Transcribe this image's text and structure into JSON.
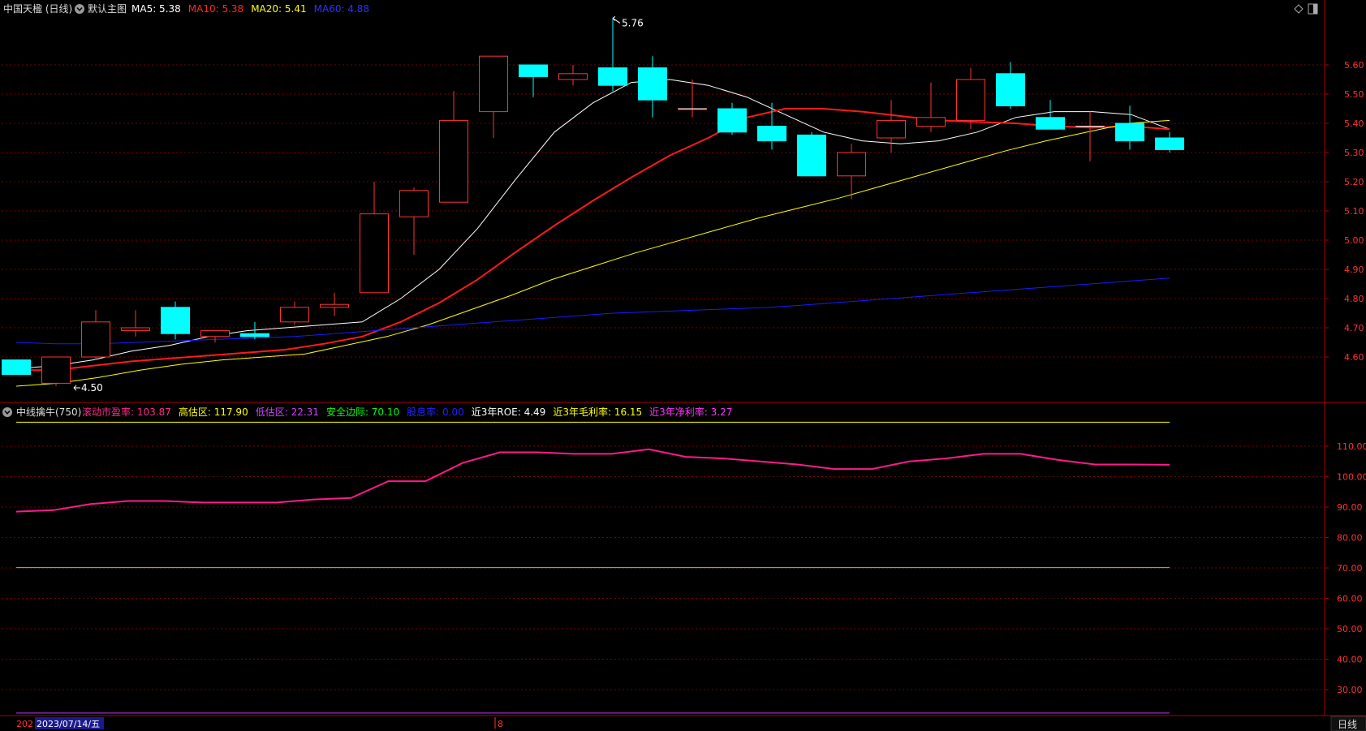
{
  "main_panel": {
    "stock_title": "中国天楹 (日线)",
    "indicator_name": "默认主图",
    "ma_labels": [
      {
        "text": "MA5: 5.38",
        "color": "#ffffff"
      },
      {
        "text": "MA10: 5.38",
        "color": "#ff2a2a"
      },
      {
        "text": "MA20: 5.41",
        "color": "#ffff00"
      },
      {
        "text": "MA60: 4.88",
        "color": "#3030ff"
      }
    ],
    "high_annotation": "5.76",
    "low_annotation": "4.50",
    "icons": [
      "dropdown-circle-icon",
      "diamond-icon",
      "panel-toggle-icon"
    ]
  },
  "sub_panel": {
    "indicator_name": "中线擒牛(750)",
    "labels": [
      {
        "text": "滚动市盈率: 103.87",
        "color": "#ff2a8a"
      },
      {
        "text": "高估区: 117.90",
        "color": "#ffff00"
      },
      {
        "text": "低估区: 22.31",
        "color": "#cc44ff"
      },
      {
        "text": "安全边际: 70.10",
        "color": "#00ff00"
      },
      {
        "text": "股息率: 0.00",
        "color": "#2222ff"
      },
      {
        "text": "近3年ROE: 4.49",
        "color": "#ffffff"
      },
      {
        "text": "近3年毛利率: 16.15",
        "color": "#ffff00"
      },
      {
        "text": "近3年净利率: 3.27",
        "color": "#ff33ff"
      }
    ]
  },
  "bottom_bar": {
    "year_prefix": "202",
    "cursor_date": "2023/07/14/五",
    "month_tick": "8",
    "period_label": "日线"
  },
  "colors": {
    "up": "#ff3333",
    "down": "#00ffff",
    "ma5": "#ffffff",
    "ma10": "#ff1a1a",
    "ma20": "#ffff00",
    "ma60": "#1a1aff",
    "pe_line": "#ff1a8c",
    "high_zone": "#ffff00",
    "low_zone": "#cc33ff",
    "safety": "#33ff33",
    "axis": "#aa0000",
    "grid": "#7a0000",
    "tick_text": "#ff3333"
  },
  "chart_data": [
    {
      "type": "candlestick",
      "y_ticks": [
        "5.60",
        "5.50",
        "5.40",
        "5.30",
        "5.20",
        "5.10",
        "5.00",
        "4.90",
        "4.80",
        "4.70",
        "4.60"
      ],
      "ylim": [
        4.48,
        5.78
      ],
      "grid": true,
      "candles": [
        {
          "open": 4.59,
          "close": 4.54,
          "high": 4.59,
          "low": 4.54
        },
        {
          "open": 4.51,
          "close": 4.6,
          "high": 4.6,
          "low": 4.5
        },
        {
          "open": 4.6,
          "close": 4.72,
          "high": 4.76,
          "low": 4.59
        },
        {
          "open": 4.69,
          "close": 4.7,
          "high": 4.76,
          "low": 4.67
        },
        {
          "open": 4.77,
          "close": 4.68,
          "high": 4.79,
          "low": 4.66
        },
        {
          "open": 4.67,
          "close": 4.69,
          "high": 4.69,
          "low": 4.65
        },
        {
          "open": 4.68,
          "close": 4.67,
          "high": 4.72,
          "low": 4.66
        },
        {
          "open": 4.72,
          "close": 4.77,
          "high": 4.79,
          "low": 4.71
        },
        {
          "open": 4.77,
          "close": 4.78,
          "high": 4.82,
          "low": 4.74
        },
        {
          "open": 4.82,
          "close": 5.09,
          "high": 5.2,
          "low": 4.82
        },
        {
          "open": 5.08,
          "close": 5.17,
          "high": 5.18,
          "low": 4.95
        },
        {
          "open": 5.13,
          "close": 5.41,
          "high": 5.51,
          "low": 5.13
        },
        {
          "open": 5.44,
          "close": 5.63,
          "high": 5.63,
          "low": 5.35
        },
        {
          "open": 5.6,
          "close": 5.56,
          "high": 5.6,
          "low": 5.49
        },
        {
          "open": 5.55,
          "close": 5.57,
          "high": 5.6,
          "low": 5.53
        },
        {
          "open": 5.59,
          "close": 5.53,
          "high": 5.76,
          "low": 5.51
        },
        {
          "open": 5.59,
          "close": 5.48,
          "high": 5.63,
          "low": 5.42
        },
        {
          "open": 5.45,
          "close": 5.45,
          "high": 5.55,
          "low": 5.42
        },
        {
          "open": 5.45,
          "close": 5.37,
          "high": 5.47,
          "low": 5.36
        },
        {
          "open": 5.39,
          "close": 5.34,
          "high": 5.47,
          "low": 5.31
        },
        {
          "open": 5.36,
          "close": 5.22,
          "high": 5.37,
          "low": 5.22
        },
        {
          "open": 5.22,
          "close": 5.3,
          "high": 5.33,
          "low": 5.14
        },
        {
          "open": 5.35,
          "close": 5.41,
          "high": 5.48,
          "low": 5.3
        },
        {
          "open": 5.39,
          "close": 5.42,
          "high": 5.54,
          "low": 5.37
        },
        {
          "open": 5.41,
          "close": 5.55,
          "high": 5.59,
          "low": 5.38
        },
        {
          "open": 5.57,
          "close": 5.46,
          "high": 5.61,
          "low": 5.45
        },
        {
          "open": 5.42,
          "close": 5.38,
          "high": 5.48,
          "low": 5.38
        },
        {
          "open": 5.39,
          "close": 5.39,
          "high": 5.44,
          "low": 5.27
        },
        {
          "open": 5.4,
          "close": 5.34,
          "high": 5.46,
          "low": 5.31
        },
        {
          "open": 5.35,
          "close": 5.31,
          "high": 5.37,
          "low": 5.3
        }
      ],
      "series": [
        {
          "name": "MA5",
          "values": [
            4.56,
            4.57,
            4.59,
            4.62,
            4.64,
            4.67,
            4.69,
            4.7,
            4.71,
            4.72,
            4.8,
            4.9,
            5.04,
            5.21,
            5.37,
            5.47,
            5.54,
            5.55,
            5.53,
            5.49,
            5.43,
            5.37,
            5.34,
            5.33,
            5.34,
            5.37,
            5.42,
            5.44,
            5.44,
            5.43,
            5.38
          ]
        },
        {
          "name": "MA10",
          "values": [
            4.555,
            4.555,
            4.57,
            4.585,
            4.595,
            4.605,
            4.615,
            4.625,
            4.645,
            4.67,
            4.72,
            4.785,
            4.865,
            4.96,
            5.05,
            5.135,
            5.215,
            5.29,
            5.35,
            5.42,
            5.45,
            5.45,
            5.44,
            5.425,
            5.41,
            5.405,
            5.4,
            5.39,
            5.385,
            5.39,
            5.38
          ]
        },
        {
          "name": "MA20",
          "values": [
            4.5,
            4.51,
            4.53,
            4.555,
            4.575,
            4.59,
            4.6,
            4.61,
            4.64,
            4.67,
            4.71,
            4.76,
            4.81,
            4.865,
            4.91,
            4.955,
            4.995,
            5.035,
            5.075,
            5.11,
            5.145,
            5.185,
            5.225,
            5.265,
            5.305,
            5.34,
            5.37,
            5.4,
            5.41
          ]
        },
        {
          "name": "MA60",
          "values": [
            4.65,
            4.645,
            4.645,
            4.65,
            4.655,
            4.66,
            4.665,
            4.67,
            4.68,
            4.69,
            4.7,
            4.71,
            4.72,
            4.73,
            4.74,
            4.75,
            4.755,
            4.76,
            4.765,
            4.77,
            4.78,
            4.79,
            4.8,
            4.81,
            4.82,
            4.83,
            4.84,
            4.85,
            4.86,
            4.87
          ]
        }
      ]
    },
    {
      "type": "line",
      "y_ticks": [
        "110.00",
        "100.00",
        "90.00",
        "80.00",
        "70.00",
        "60.00",
        "50.00",
        "40.00",
        "30.00"
      ],
      "ylim": [
        22,
        120
      ],
      "grid": true,
      "series": [
        {
          "name": "滚动市盈率",
          "values": [
            88.5,
            89.0,
            91.0,
            92.0,
            92.0,
            91.5,
            91.5,
            91.5,
            92.5,
            93.0,
            98.5,
            98.5,
            104.5,
            108.0,
            108.0,
            107.5,
            107.5,
            109.0,
            106.5,
            106.0,
            105.0,
            104.0,
            102.5,
            102.5,
            105.0,
            106.0,
            107.5,
            107.5,
            105.5,
            104.0,
            104.0,
            103.9
          ]
        },
        {
          "name": "高估区",
          "values": [
            117.9
          ]
        },
        {
          "name": "安全边际",
          "values": [
            70.1
          ]
        },
        {
          "name": "低估区",
          "values": [
            22.31
          ]
        }
      ]
    }
  ]
}
